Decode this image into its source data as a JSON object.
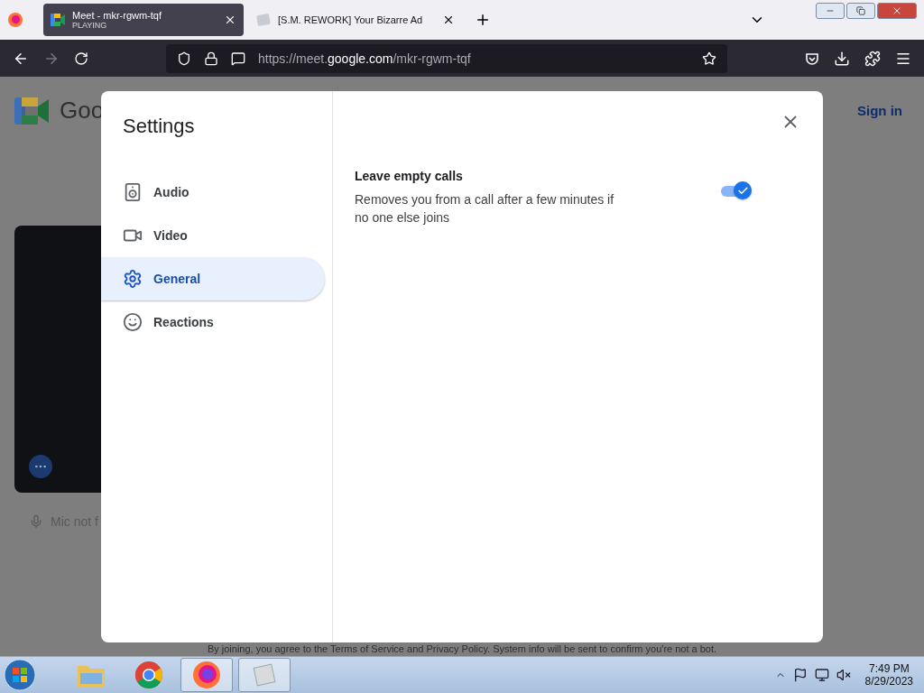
{
  "browser": {
    "tabs": [
      {
        "title": "Meet - mkr-rgwm-tqf",
        "subtitle": "PLAYING",
        "kind": "meet",
        "selected": true
      },
      {
        "title": "[S.M. REWORK] Your Bizarre Ad",
        "kind": "generic",
        "selected": false
      }
    ],
    "url": {
      "scheme": "https://meet.",
      "domain": "google.com",
      "path": "/mkr-rgwm-tqf"
    }
  },
  "page": {
    "logo_text": "Goo",
    "sign_in": "Sign in",
    "mic_status": "Mic not f",
    "footer": "By joining, you agree to the Terms of Service and Privacy Policy. System info will be sent to confirm you're not a bot."
  },
  "settings": {
    "title": "Settings",
    "nav": [
      {
        "label": "Audio",
        "kind": "audio",
        "selected": false
      },
      {
        "label": "Video",
        "kind": "video",
        "selected": false
      },
      {
        "label": "General",
        "kind": "general",
        "selected": true
      },
      {
        "label": "Reactions",
        "kind": "reactions",
        "selected": false
      }
    ],
    "options": [
      {
        "title": "Leave empty calls",
        "description": "Removes you from a call after a few minutes if no one else joins",
        "on": true
      }
    ]
  },
  "taskbar": {
    "apps": [
      {
        "kind": "explorer",
        "open": false
      },
      {
        "kind": "chrome",
        "open": false
      },
      {
        "kind": "firefox",
        "open": true
      },
      {
        "kind": "roblox",
        "open": true
      }
    ],
    "time": "7:49 PM",
    "date": "8/29/2023"
  }
}
